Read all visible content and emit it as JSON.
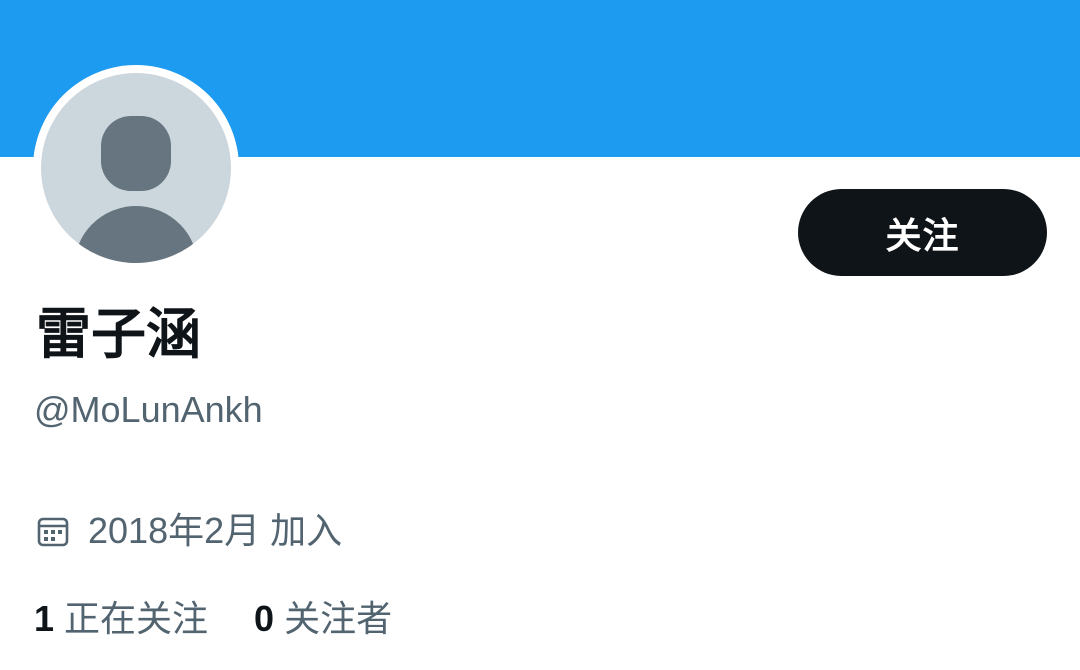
{
  "colors": {
    "banner": "#1d9bf0",
    "avatar_bg": "#ccd6dd",
    "avatar_figure": "#66757f",
    "follow_button_bg": "#0f1419",
    "follow_button_text": "#ffffff",
    "primary_text": "#0f1419",
    "secondary_text": "#536471"
  },
  "profile": {
    "display_name": "雷子涵",
    "handle": "@MoLunAnkh",
    "avatar_icon": "default-person-avatar",
    "joined": "2018年2月 加入",
    "joined_icon": "calendar-icon"
  },
  "actions": {
    "follow_label": "关注"
  },
  "stats": {
    "following_count": "1",
    "following_label": "正在关注",
    "followers_count": "0",
    "followers_label": "关注者"
  }
}
